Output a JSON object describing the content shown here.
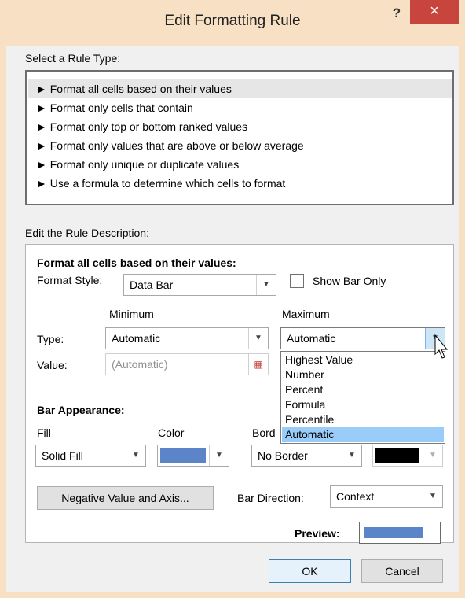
{
  "window": {
    "title": "Edit Formatting Rule",
    "help_label": "?",
    "close_label": "×"
  },
  "rule_type": {
    "heading": "Select a Rule Type:",
    "items": [
      "► Format all cells based on their values",
      "► Format only cells that contain",
      "► Format only top or bottom ranked values",
      "► Format only values that are above or below average",
      "► Format only unique or duplicate values",
      "► Use a formula to determine which cells to format"
    ],
    "selected_index": 0
  },
  "description": {
    "heading": "Edit the Rule Description:",
    "subheading": "Format all cells based on their values:",
    "format_style_label": "Format Style:",
    "format_style_value": "Data Bar",
    "show_bar_only_label": "Show Bar Only",
    "minimum_header": "Minimum",
    "maximum_header": "Maximum",
    "type_label": "Type:",
    "value_label": "Value:",
    "min_type_value": "Automatic",
    "min_value_placeholder": "(Automatic)",
    "max_type_value": "Automatic",
    "dropdown_options": [
      "Highest Value",
      "Number",
      "Percent",
      "Formula",
      "Percentile",
      "Automatic"
    ],
    "dropdown_selected_index": 5
  },
  "bar_appearance": {
    "heading": "Bar Appearance:",
    "fill_label": "Fill",
    "color_label": "Color",
    "border_label": "Bord",
    "fill_value": "Solid Fill",
    "border_value": "No Border",
    "fill_color": "#5b85c8",
    "border_color": "#000000",
    "negative_button": "Negative Value and Axis...",
    "bar_direction_label": "Bar Direction:",
    "bar_direction_value": "Context",
    "preview_label": "Preview:"
  },
  "buttons": {
    "ok": "OK",
    "cancel": "Cancel"
  }
}
